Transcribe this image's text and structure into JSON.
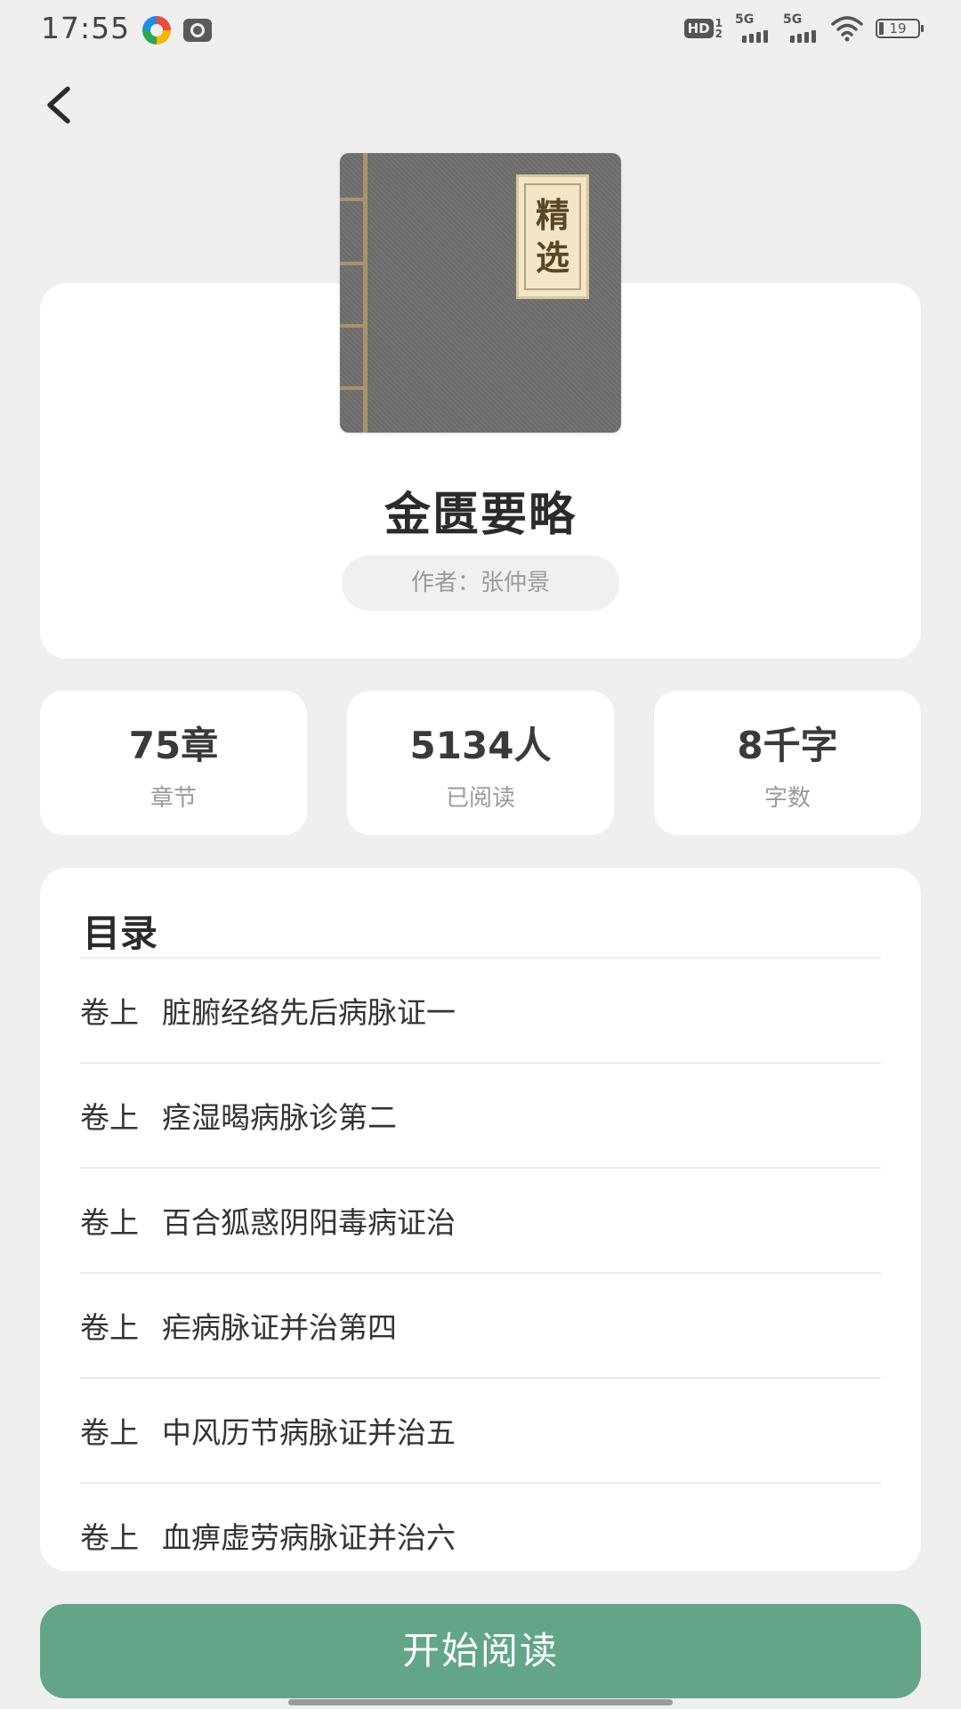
{
  "status_bar": {
    "time": "17:55",
    "hd_label": "HD",
    "hd_sub_top": "1",
    "hd_sub_bottom": "2",
    "signal1_label": "5G",
    "signal2_label": "5G",
    "battery": "19"
  },
  "book": {
    "cover_label_line1": "精",
    "cover_label_line2": "选",
    "title": "金匮要略",
    "author": "作者：张仲景"
  },
  "stats": [
    {
      "value": "75章",
      "label": "章节"
    },
    {
      "value": "5134人",
      "label": "已阅读"
    },
    {
      "value": "8千字",
      "label": "字数"
    }
  ],
  "toc": {
    "title": "目录",
    "items": [
      {
        "volume": "卷上",
        "chapter": "脏腑经络先后病脉证一"
      },
      {
        "volume": "卷上",
        "chapter": "痉湿暍病脉诊第二"
      },
      {
        "volume": "卷上",
        "chapter": "百合狐惑阴阳毒病证治"
      },
      {
        "volume": "卷上",
        "chapter": "疟病脉证并治第四"
      },
      {
        "volume": "卷上",
        "chapter": "中风历节病脉证并治五"
      },
      {
        "volume": "卷上",
        "chapter": "血痹虚劳病脉证并治六"
      }
    ]
  },
  "actions": {
    "start_reading": "开始阅读"
  },
  "colors": {
    "accent": "#62a589",
    "background": "#efefef"
  }
}
